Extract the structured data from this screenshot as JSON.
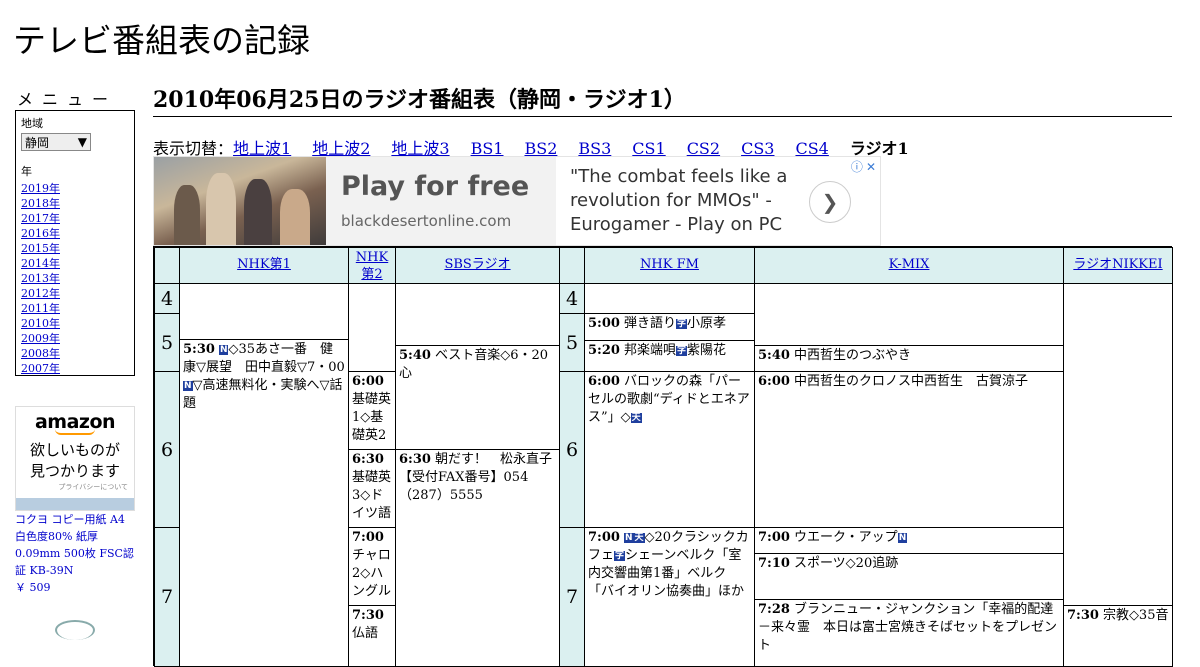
{
  "site": {
    "title": "テレビ番組表の記録"
  },
  "menu": {
    "label": "メニュー",
    "region_label": "地域",
    "region_value": "静岡",
    "year_label": "年",
    "years": [
      "2019年",
      "2018年",
      "2017年",
      "2016年",
      "2015年",
      "2014年",
      "2013年",
      "2012年",
      "2011年",
      "2010年",
      "2009年",
      "2008年",
      "2007年"
    ]
  },
  "ad_left": {
    "brand": "amazon",
    "line1": "欲しいものが",
    "line2": "見つかります",
    "privacy": "プライバシーについて"
  },
  "product": {
    "name": "コクヨ コピー用紙 A4 白色度80% 紙厚 0.09mm 500枚 FSC認証 KB-39N",
    "price": "￥ 509"
  },
  "heading": "2010年06月25日のラジオ番組表（静岡・ラジオ1）",
  "switcher": {
    "label": "表示切替：",
    "links": [
      "地上波1",
      "地上波2",
      "地上波3",
      "BS1",
      "BS2",
      "BS3",
      "CS1",
      "CS2",
      "CS3",
      "CS4"
    ],
    "current": "ラジオ1"
  },
  "banner": {
    "cta": "Play for free",
    "domain": "blackdesertonline.com",
    "quote": "\"The combat feels like a revolution for MMOs\" - Eurogamer - Play on PC"
  },
  "channels": [
    "NHK第1",
    "NHK第2",
    "SBSラジオ",
    "NHK FM",
    "K-MIX",
    "ラジオNIKKEI"
  ],
  "hours": [
    "4",
    "5",
    "6",
    "7"
  ],
  "badges": {
    "news": "N",
    "stereo": "天",
    "jimaku": "字"
  },
  "programs": {
    "nhk1_530_time": "5:30",
    "nhk1_530_text": "◇35あさ一番　健康▽展望　田中直毅▽7・00",
    "nhk1_530_text2": "▽高速無料化・実験へ▽話題",
    "nhk2_600_time": "6:00",
    "nhk2_600_text": "基礎英1◇基礎英2",
    "nhk2_630_time": "6:30",
    "nhk2_630_text": "基礎英3◇ドイツ語",
    "nhk2_700_time": "7:00",
    "nhk2_700_text": "チャロ2◇ハングル",
    "nhk2_730_time": "7:30",
    "nhk2_730_text": "仏語",
    "sbs_540_time": "5:40",
    "sbs_540_text": "ベスト音楽◇6・20心",
    "sbs_630_time": "6:30",
    "sbs_630_text": "朝だす！　松永直子【受付FAX番号】054（287）5555",
    "fm_500_time": "5:00",
    "fm_500_text": "弾き語り",
    "fm_500_text2": "小原孝",
    "fm_520_time": "5:20",
    "fm_520_text": "邦楽端唄",
    "fm_520_text2": "紫陽花",
    "fm_600_time": "6:00",
    "fm_600_text": "バロックの森「パーセルの歌劇“ディドとエネアス”」◇",
    "fm_700_time": "7:00",
    "fm_700_text": "◇20クラシックカフェ",
    "fm_700_text2": "シェーンベルク「室内交響曲第1番」ベルク「バイオリン協奏曲」ほか",
    "kmix_540_time": "5:40",
    "kmix_540_text": "中西哲生のつぶやき",
    "kmix_600_time": "6:00",
    "kmix_600_text": "中西哲生のクロノス中西哲生　古賀涼子",
    "kmix_700_time": "7:00",
    "kmix_700_text": "ウエーク・アップ",
    "kmix_710_time": "7:10",
    "kmix_710_text": "スポーツ◇20追跡",
    "kmix_728_time": "7:28",
    "kmix_728_text": "ブランニュー・ジャンクション「幸福的配達－来々霊　本日は富士宮焼きそばセットをプレゼント",
    "nikkei_730_time": "7:30",
    "nikkei_730_text": "宗教◇35音"
  },
  "colors": {
    "header_bg": "#dbf0f0",
    "link": "#0000cc",
    "badge": "#1f3f9e"
  }
}
